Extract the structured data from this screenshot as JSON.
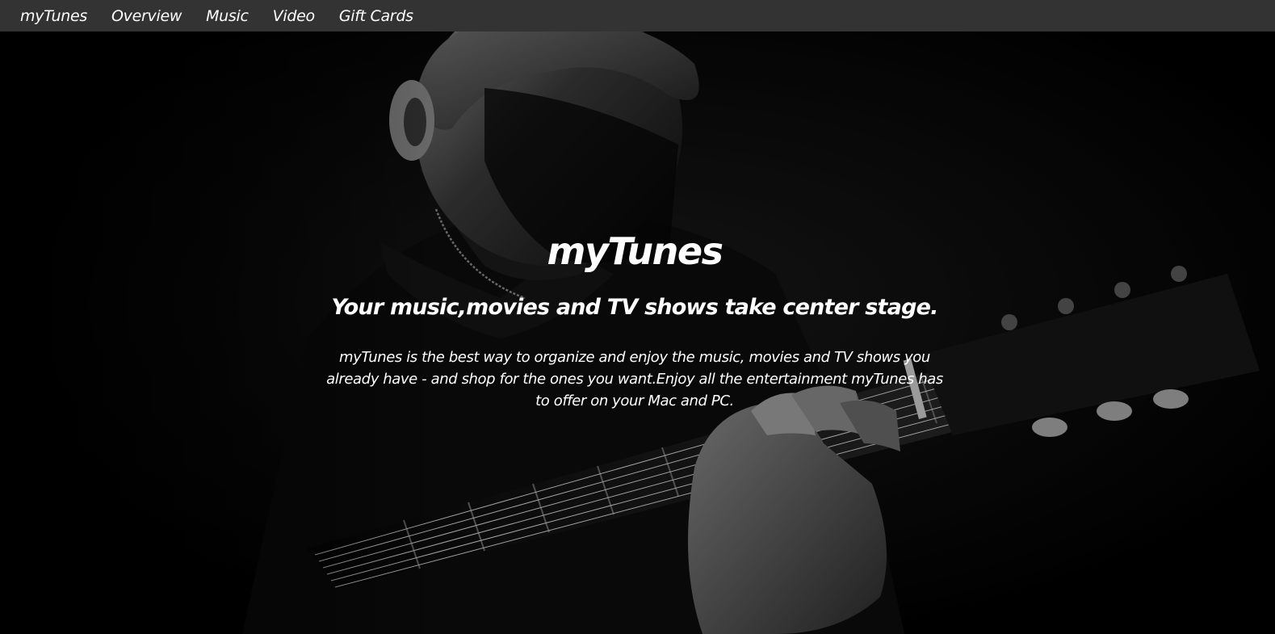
{
  "nav": {
    "brand": "myTunes",
    "items": [
      {
        "label": "Overview"
      },
      {
        "label": "Music"
      },
      {
        "label": "Video"
      },
      {
        "label": "Gift Cards"
      }
    ]
  },
  "hero": {
    "title": "myTunes",
    "subtitle": "Your music,movies and TV shows take center stage.",
    "description": "myTunes is the best way to organize and enjoy the music, movies and TV shows you already have - and shop for the ones you want.Enjoy all the entertainment myTunes has to offer on your Mac and PC.",
    "background_image": "black-and-white photo of a man playing acoustic guitar"
  },
  "colors": {
    "navbar_bg": "#333333",
    "hero_bg": "#000000",
    "text": "#ffffff"
  }
}
